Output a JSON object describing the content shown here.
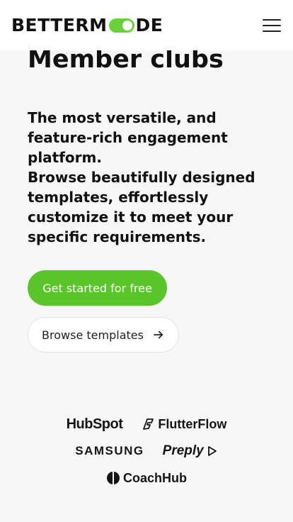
{
  "header": {
    "logo_part1": "BETTERM",
    "logo_part2": "DE",
    "menu_icon": "hamburger-icon"
  },
  "hero": {
    "title": "Member clubs",
    "subtitle": "The most versatile, and feature-rich engagement platform.\nBrowse beautifully designed templates, effortlessly customize it to meet your specific requirements."
  },
  "actions": {
    "primary_label": "Get started for free",
    "secondary_label": "Browse templates",
    "secondary_icon": "arrow-right-icon"
  },
  "customers": [
    {
      "name": "HubSpot"
    },
    {
      "name": "FlutterFlow"
    },
    {
      "name": "SAMSUNG"
    },
    {
      "name": "Preply"
    },
    {
      "name": "CoachHub"
    }
  ],
  "colors": {
    "accent": "#59c52b",
    "logo_toggle": "#6bd13a",
    "background": "#f7f7f7",
    "header_bg": "#ffffff"
  }
}
